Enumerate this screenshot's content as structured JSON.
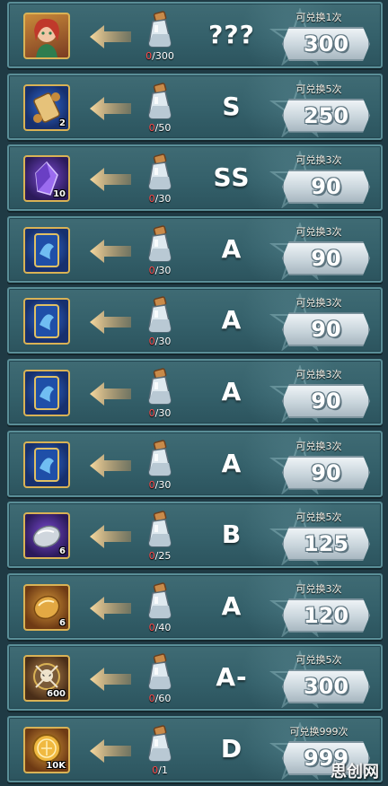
{
  "rows": [
    {
      "item_icon": "hero-portrait-icon",
      "item_style": "portrait",
      "item_count": "",
      "progress_current": "0",
      "progress_total": "/300",
      "grade": "???",
      "limit": "可兑换1次",
      "cost": "300"
    },
    {
      "item_icon": "scroll-icon",
      "item_style": "blue",
      "item_count": "2",
      "progress_current": "0",
      "progress_total": "/50",
      "grade": "S",
      "limit": "可兑换5次",
      "cost": "250"
    },
    {
      "item_icon": "purple-crystal-icon",
      "item_style": "purple",
      "item_count": "10",
      "progress_current": "0",
      "progress_total": "/30",
      "grade": "SS",
      "limit": "可兑换3次",
      "cost": "90"
    },
    {
      "item_icon": "blue-card-icon",
      "item_style": "blue",
      "item_count": "",
      "progress_current": "0",
      "progress_total": "/30",
      "grade": "A",
      "limit": "可兑换3次",
      "cost": "90"
    },
    {
      "item_icon": "blue-card-icon",
      "item_style": "blue",
      "item_count": "",
      "progress_current": "0",
      "progress_total": "/30",
      "grade": "A",
      "limit": "可兑换3次",
      "cost": "90"
    },
    {
      "item_icon": "blue-card-icon",
      "item_style": "blue",
      "item_count": "",
      "progress_current": "0",
      "progress_total": "/30",
      "grade": "A",
      "limit": "可兑换3次",
      "cost": "90"
    },
    {
      "item_icon": "blue-card-icon",
      "item_style": "blue",
      "item_count": "",
      "progress_current": "0",
      "progress_total": "/30",
      "grade": "A",
      "limit": "可兑换3次",
      "cost": "90"
    },
    {
      "item_icon": "silver-stone-icon",
      "item_style": "purple",
      "item_count": "6",
      "progress_current": "0",
      "progress_total": "/25",
      "grade": "B",
      "limit": "可兑换5次",
      "cost": "125"
    },
    {
      "item_icon": "gold-stone-icon",
      "item_style": "gold",
      "item_count": "6",
      "progress_current": "0",
      "progress_total": "/40",
      "grade": "A",
      "limit": "可兑换3次",
      "cost": "120"
    },
    {
      "item_icon": "skull-emblem-icon",
      "item_style": "bronze",
      "item_count": "600",
      "progress_current": "0",
      "progress_total": "/60",
      "grade": "A-",
      "limit": "可兑换5次",
      "cost": "300"
    },
    {
      "item_icon": "gold-coin-icon",
      "item_style": "gold",
      "item_count": "10K",
      "progress_current": "0",
      "progress_total": "/1",
      "grade": "D",
      "limit": "可兑换999次",
      "cost": "999"
    }
  ],
  "watermark": "思创网",
  "colors": {
    "accent_gold": "#d9b255",
    "progress_current": "#ff4a4a",
    "row_bg": "#3f6b74"
  }
}
